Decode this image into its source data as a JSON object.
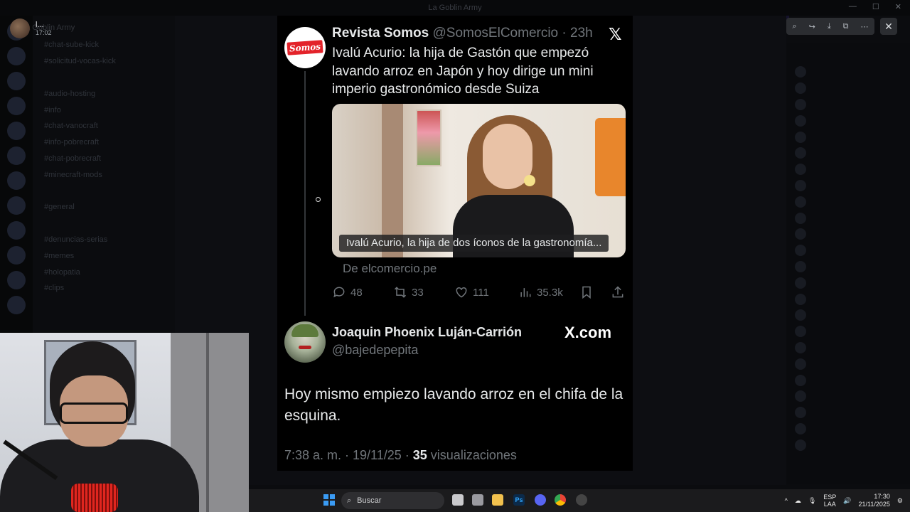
{
  "window": {
    "title": "La Goblin Army"
  },
  "user_chip": {
    "name": "l...",
    "time": "17:02"
  },
  "discord": {
    "server_name": "La Goblin Army",
    "channels": [
      {
        "label": "chat-sube-kick"
      },
      {
        "label": "solicitud-vocas-kick"
      },
      {
        "label": "audio-hosting"
      },
      {
        "label": "info"
      },
      {
        "label": "chat-vanocraft"
      },
      {
        "label": "info-pobrecraft"
      },
      {
        "label": "chat-pobrecraft"
      },
      {
        "label": "minecraft-mods"
      },
      {
        "label": "general"
      },
      {
        "label": "denuncias-serias"
      },
      {
        "label": "memes"
      },
      {
        "label": "holopatia"
      },
      {
        "label": "clips"
      }
    ]
  },
  "tweet": {
    "author_name": "Revista Somos",
    "author_handle": "@SomosElComercio",
    "time": "· 23h",
    "avatar_text": "Somos",
    "text": "Ivalú Acurio: la hija de Gastón que empezó lavando arroz en Japón y hoy dirige un mini imperio gastronómico desde Suiza",
    "image_caption": "Ivalú Acurio, la hija de dos íconos de la gastronomía...",
    "source": "De elcomercio.pe",
    "replies": "48",
    "retweets": "33",
    "likes": "111",
    "views": "35.3k"
  },
  "reply": {
    "author_name": "Joaquin Phoenix Luján-Carrión",
    "author_handle": "@bajedepepita",
    "brand": "X.com",
    "text": "Hoy mismo empiezo lavando arroz en el chifa de la esquina.",
    "meta_prefix": "7:38 a. m. · 19/11/25 · ",
    "view_count": "35",
    "meta_suffix": " visualizaciones"
  },
  "taskbar": {
    "search_placeholder": "Buscar",
    "lang_line1": "ESP",
    "lang_line2": "LAA",
    "time": "17:30",
    "date": "21/11/2025"
  },
  "colors": {
    "accent": "#1d9bf0",
    "muted": "#71767b",
    "text": "#e7e9ea"
  }
}
